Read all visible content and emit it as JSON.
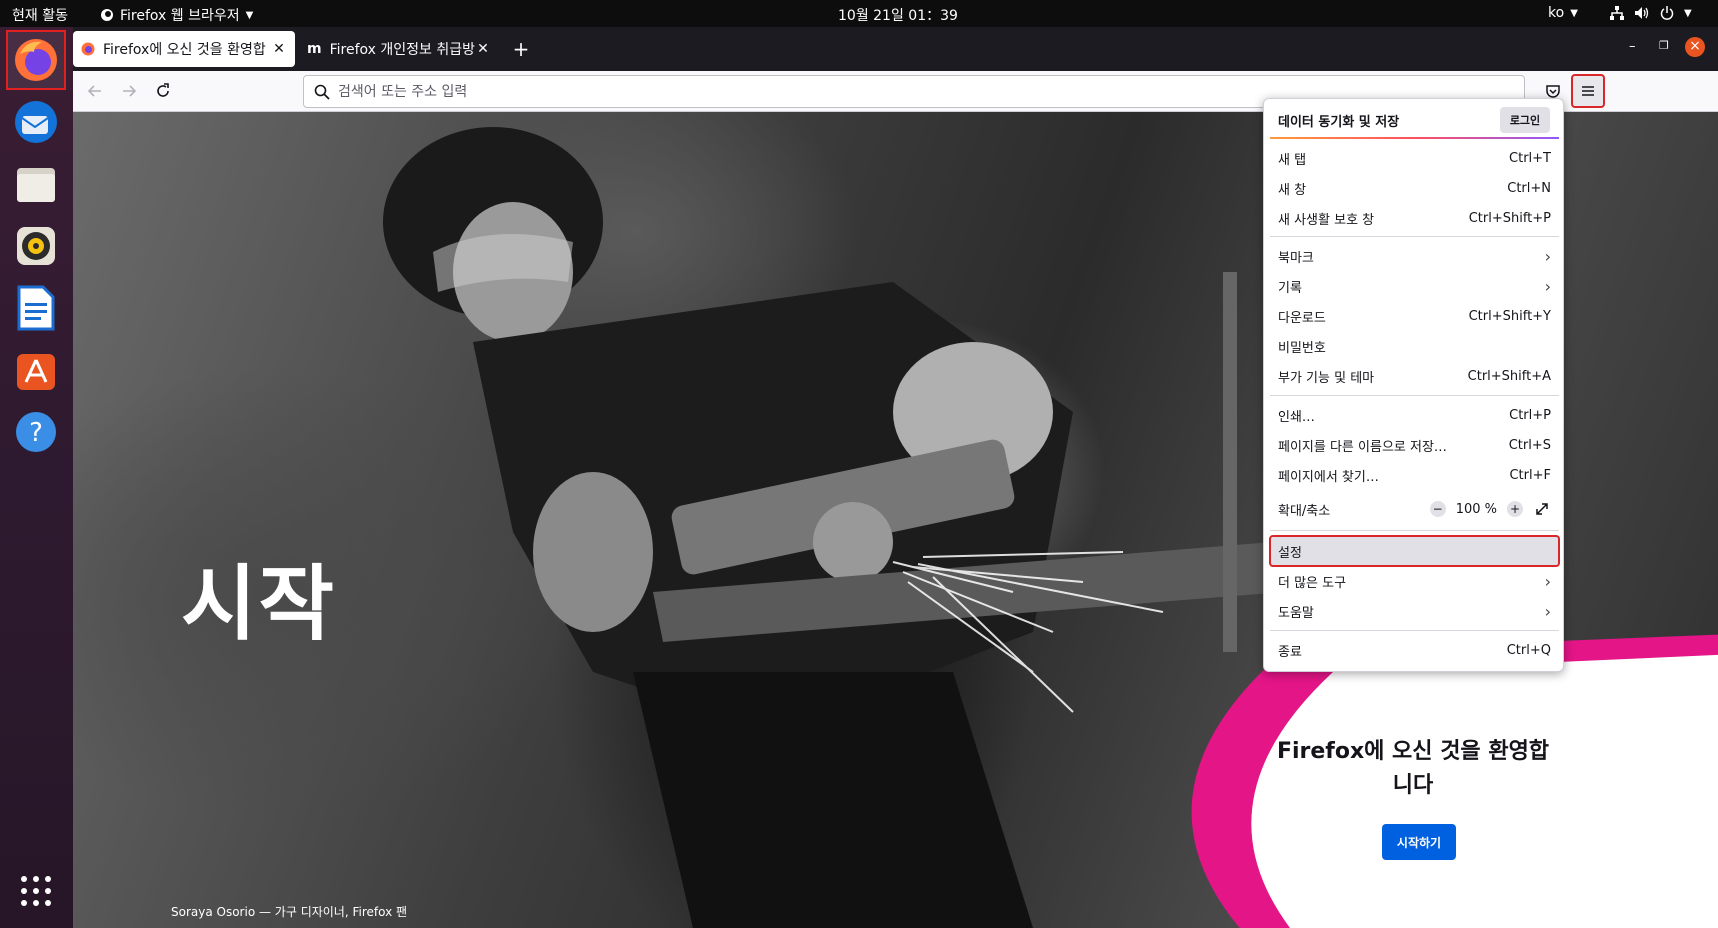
{
  "topbar": {
    "activities": "현재 활동",
    "app_name": "Firefox 웹 브라우저",
    "clock": "10월 21일 01：39",
    "lang": "ko"
  },
  "dock": {
    "apps": [
      "firefox-icon",
      "thunderbird-icon",
      "files-icon",
      "rhythmbox-icon",
      "writer-icon",
      "software-icon",
      "help-icon"
    ],
    "show_apps": "show-apps-icon"
  },
  "tabs": [
    {
      "label": "Firefox에 오신 것을 환영합",
      "selected": true
    },
    {
      "label": "Firefox 개인정보 취급방침",
      "selected": false
    }
  ],
  "new_tab": "+",
  "window_controls": {
    "minimize": "–",
    "restore": "❐",
    "close": "×"
  },
  "urlbar": {
    "placeholder": "검색어 또는 주소 입력"
  },
  "page": {
    "heading": "시작",
    "credit": "Soraya Osorio — 가구 디자이너, Firefox 팬",
    "welcome": "Firefox에 오신 것을 환영합니다",
    "get_started": "시작하기"
  },
  "menu": {
    "sync_title": "데이터 동기화 및 저장",
    "sign_in": "로그인",
    "items": [
      {
        "label": "새 탭",
        "shortcut": "Ctrl+T"
      },
      {
        "label": "새 창",
        "shortcut": "Ctrl+N"
      },
      {
        "label": "새 사생활 보호 창",
        "shortcut": "Ctrl+Shift+P"
      },
      {
        "label": "북마크",
        "shortcut": ""
      },
      {
        "label": "기록",
        "shortcut": ""
      },
      {
        "label": "다운로드",
        "shortcut": "Ctrl+Shift+Y"
      },
      {
        "label": "비밀번호",
        "shortcut": ""
      },
      {
        "label": "부가 기능 및 테마",
        "shortcut": "Ctrl+Shift+A"
      },
      {
        "label": "인쇄…",
        "shortcut": "Ctrl+P"
      },
      {
        "label": "페이지를 다른 이름으로 저장…",
        "shortcut": "Ctrl+S"
      },
      {
        "label": "페이지에서 찾기…",
        "shortcut": "Ctrl+F"
      },
      {
        "label": "확대/축소",
        "shortcut": ""
      },
      {
        "label": "설정",
        "shortcut": ""
      },
      {
        "label": "더 많은 도구",
        "shortcut": ""
      },
      {
        "label": "도움말",
        "shortcut": ""
      },
      {
        "label": "종료",
        "shortcut": "Ctrl+Q"
      }
    ],
    "zoom": {
      "minus": "−",
      "value": "100 %",
      "plus": "+"
    }
  },
  "colors": {
    "accent": "#0061e0",
    "highlight_border": "#d9262a",
    "pink": "#e31587"
  }
}
